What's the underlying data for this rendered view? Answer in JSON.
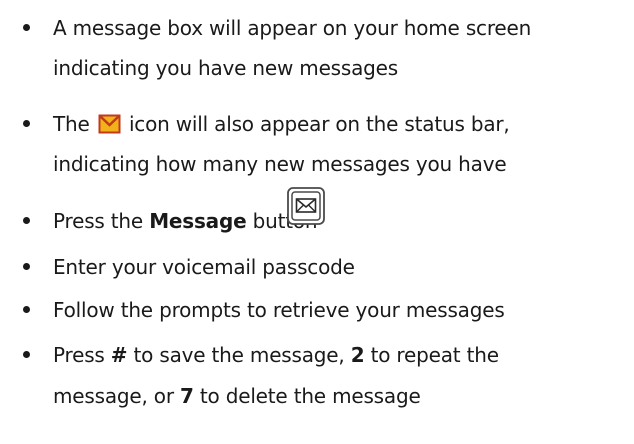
{
  "items": [
    {
      "lines": [
        "A message box will appear on your home screen",
        "indicating you have new messages"
      ]
    },
    {
      "line1_prefix": "The",
      "icon": "envelope-icon",
      "line1_suffix": "icon will also appear on the status bar,",
      "line2": "indicating how many new messages you have"
    },
    {
      "prefix": "Press the ",
      "bold": "Message",
      "suffix": " button",
      "icon": "message-button-icon"
    },
    {
      "text": "Enter your voicemail passcode"
    },
    {
      "text": "Follow the prompts to retrieve your messages"
    },
    {
      "l1_a": "Press ",
      "l1_b1": "#",
      "l1_c": " to save the message, ",
      "l1_b2": "2",
      "l1_d": " to repeat the",
      "l2_a": "message, or ",
      "l2_b": "7",
      "l2_c": " to delete the message"
    }
  ],
  "colors": {
    "text": "#1a1a1a",
    "envelope_fill": "#f2b21b",
    "envelope_border": "#c23a1c",
    "button_stroke": "#4a4a4a"
  }
}
